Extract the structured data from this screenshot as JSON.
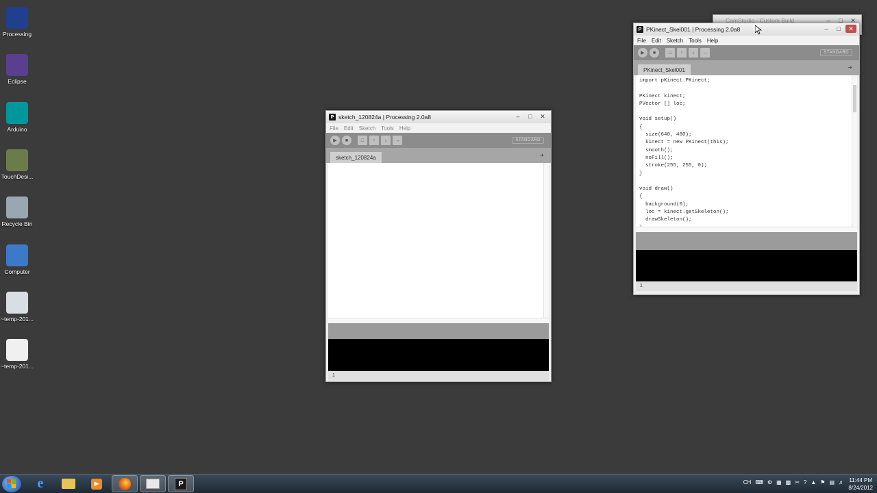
{
  "desktop_icons": [
    {
      "label": "Processing",
      "icon": "processing-icon",
      "color": "#1f3f8f"
    },
    {
      "label": "Eclipse",
      "icon": "eclipse-icon",
      "color": "#5a3f8f"
    },
    {
      "label": "Arduino",
      "icon": "arduino-icon",
      "color": "#00979c"
    },
    {
      "label": "TouchDesi...",
      "icon": "touchdesigner-icon",
      "color": "#6b7b4a"
    },
    {
      "label": "Recycle Bin",
      "icon": "recycle-bin-icon",
      "color": "#9aa7b3"
    },
    {
      "label": "Computer",
      "icon": "computer-icon",
      "color": "#3c79c8"
    },
    {
      "label": "~temp-201...",
      "icon": "video-file-icon",
      "color": "#d8dee4"
    },
    {
      "label": "~temp-201...",
      "icon": "blank-file-icon",
      "color": "#f0f0f0"
    }
  ],
  "bg_window": {
    "title": "CamStudio - Custom Build"
  },
  "sketch_window": {
    "title": "sketch_120824a | Processing 2.0a8",
    "menu": [
      "File",
      "Edit",
      "Sketch",
      "Tools",
      "Help"
    ],
    "mode": "STANDARD",
    "tab": "sketch_120824a",
    "line_number": "1"
  },
  "pkinect_window": {
    "title": "PKinect_Skel001 | Processing 2.0a8",
    "menu": [
      "File",
      "Edit",
      "Sketch",
      "Tools",
      "Help"
    ],
    "mode": "STANDARD",
    "tab": "PKinect_Skel001",
    "line_number": "1",
    "code": [
      "import pKinect.PKinect;",
      "",
      "PKinect kinect;",
      "PVector [] loc;",
      "",
      "void setup()",
      "{",
      "  size(640, 480);",
      "  kinect = new PKinect(this);",
      "  smooth();",
      "  noFill();",
      "  stroke(255, 255, 0);",
      "}",
      "",
      "void draw()",
      "{",
      "  background(0);",
      "  loc = kinect.getSkeleton();",
      "  drawSkeleton();",
      "}"
    ]
  },
  "taskbar": {
    "lang": "CH",
    "time": "11:44 PM",
    "date": "8/24/2012"
  }
}
